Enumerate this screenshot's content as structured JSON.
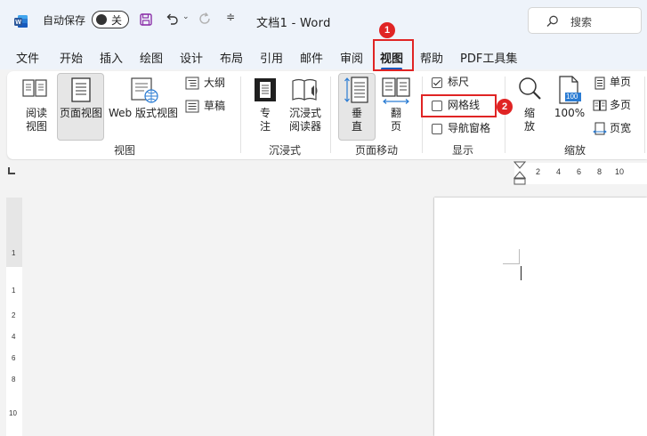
{
  "titlebar": {
    "autosave_label": "自动保存",
    "autosave_state": "关",
    "doc_title": "文档1 - Word",
    "search_placeholder": "搜索",
    "qat_more": "≑"
  },
  "tabs": [
    {
      "label": "文件"
    },
    {
      "label": "开始"
    },
    {
      "label": "插入"
    },
    {
      "label": "绘图"
    },
    {
      "label": "设计"
    },
    {
      "label": "布局"
    },
    {
      "label": "引用"
    },
    {
      "label": "邮件"
    },
    {
      "label": "审阅"
    },
    {
      "label": "视图",
      "active": true
    },
    {
      "label": "帮助"
    },
    {
      "label": "PDF工具集"
    }
  ],
  "ribbon": {
    "views": {
      "read_mode": "阅读\n视图",
      "print_layout": "页面视图",
      "web_layout": "Web 版式视图",
      "outline": "大纲",
      "draft": "草稿",
      "group_label": "视图"
    },
    "immersive": {
      "focus": "专\n注",
      "immersive_reader": "沉浸式\n阅读器",
      "group_label": "沉浸式"
    },
    "page_movement": {
      "vertical": "垂\n直",
      "side_to_side": "翻\n页",
      "group_label": "页面移动"
    },
    "show": {
      "ruler": {
        "label": "标尺",
        "checked": true
      },
      "gridlines": {
        "label": "网格线",
        "checked": false
      },
      "nav_pane": {
        "label": "导航窗格",
        "checked": false
      },
      "group_label": "显示"
    },
    "zoom": {
      "zoom_btn": "缩\n放",
      "zoom_100": "100%",
      "zoom_100_icon_text": "100",
      "one_page": "单页",
      "multiple_pages": "多页",
      "page_width": "页宽",
      "group_label": "缩放"
    }
  },
  "annotations": {
    "badge1": "1",
    "badge2": "2",
    "highlight_color": "#e02424"
  },
  "ruler": {
    "h_numbers": [
      "2",
      "4",
      "6",
      "8",
      "10"
    ],
    "v_numbers": [
      "1",
      "1",
      "2",
      "4",
      "6",
      "8",
      "10"
    ]
  },
  "colors": {
    "accent": "#185abd",
    "word_blue": "#2b579a",
    "save_icon": "#8b2fa8",
    "annotation_red": "#e02424"
  }
}
